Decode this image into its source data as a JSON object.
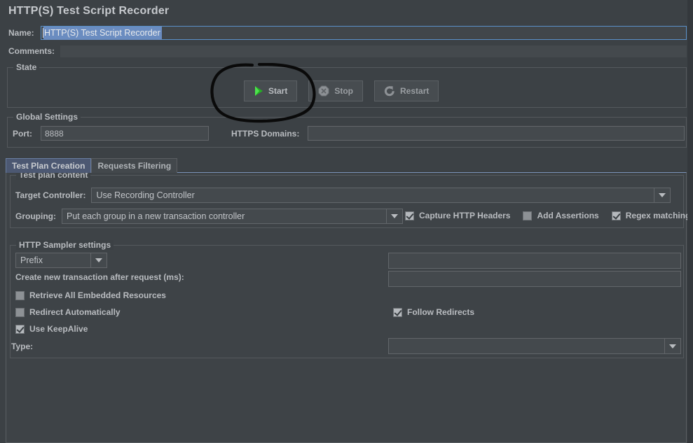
{
  "window": {
    "title": "HTTP(S) Test Script Recorder"
  },
  "name_row": {
    "label": "Name:",
    "value": "HTTP(S) Test Script Recorder"
  },
  "comments_row": {
    "label": "Comments:",
    "value": ""
  },
  "state": {
    "title": "State",
    "buttons": [
      {
        "label": "Start",
        "icon": "play-icon",
        "enabled": true
      },
      {
        "label": "Stop",
        "icon": "stop-octagon-icon",
        "enabled": false
      },
      {
        "label": "Restart",
        "icon": "restart-arrow-icon",
        "enabled": false
      }
    ]
  },
  "global_settings": {
    "title": "Global Settings",
    "port": {
      "label": "Port:",
      "value": "8888"
    },
    "https_domains": {
      "label": "HTTPS Domains:",
      "value": ""
    }
  },
  "tabs": [
    {
      "label": "Test Plan Creation",
      "active": true
    },
    {
      "label": "Requests Filtering",
      "active": false
    }
  ],
  "test_plan_content": {
    "title": "Test plan content",
    "target_controller": {
      "label": "Target Controller:",
      "value": "Use Recording Controller"
    },
    "grouping": {
      "label": "Grouping:",
      "value": "Put each group in a new transaction controller"
    },
    "checkboxes": [
      {
        "label": "Capture HTTP Headers",
        "checked": true
      },
      {
        "label": "Add Assertions",
        "checked": false
      },
      {
        "label": "Regex matching",
        "checked": true
      }
    ]
  },
  "http_sampler_settings": {
    "title": "HTTP Sampler settings",
    "prefix": {
      "value": "Prefix",
      "field_value": ""
    },
    "transaction": {
      "label": "Create new transaction after request (ms):",
      "value": ""
    },
    "checkboxes": [
      {
        "label": "Retrieve All Embedded Resources",
        "checked": false
      },
      {
        "label": "Redirect Automatically",
        "checked": false
      },
      {
        "label": "Use KeepAlive",
        "checked": true
      },
      {
        "label": "Follow Redirects",
        "checked": true
      }
    ],
    "type": {
      "label": "Type:",
      "value": ""
    }
  },
  "annotation": {
    "shape": "hand-drawn-oval",
    "color": "#000000",
    "targets": "Start"
  },
  "colors": {
    "background": "#3c4145",
    "field": "#44494d",
    "border": "#62666a",
    "text": "#b9bcc0",
    "tab_active": "#4c5872",
    "selection": "#6a8cc0",
    "start_green": "#2fbf2f"
  }
}
